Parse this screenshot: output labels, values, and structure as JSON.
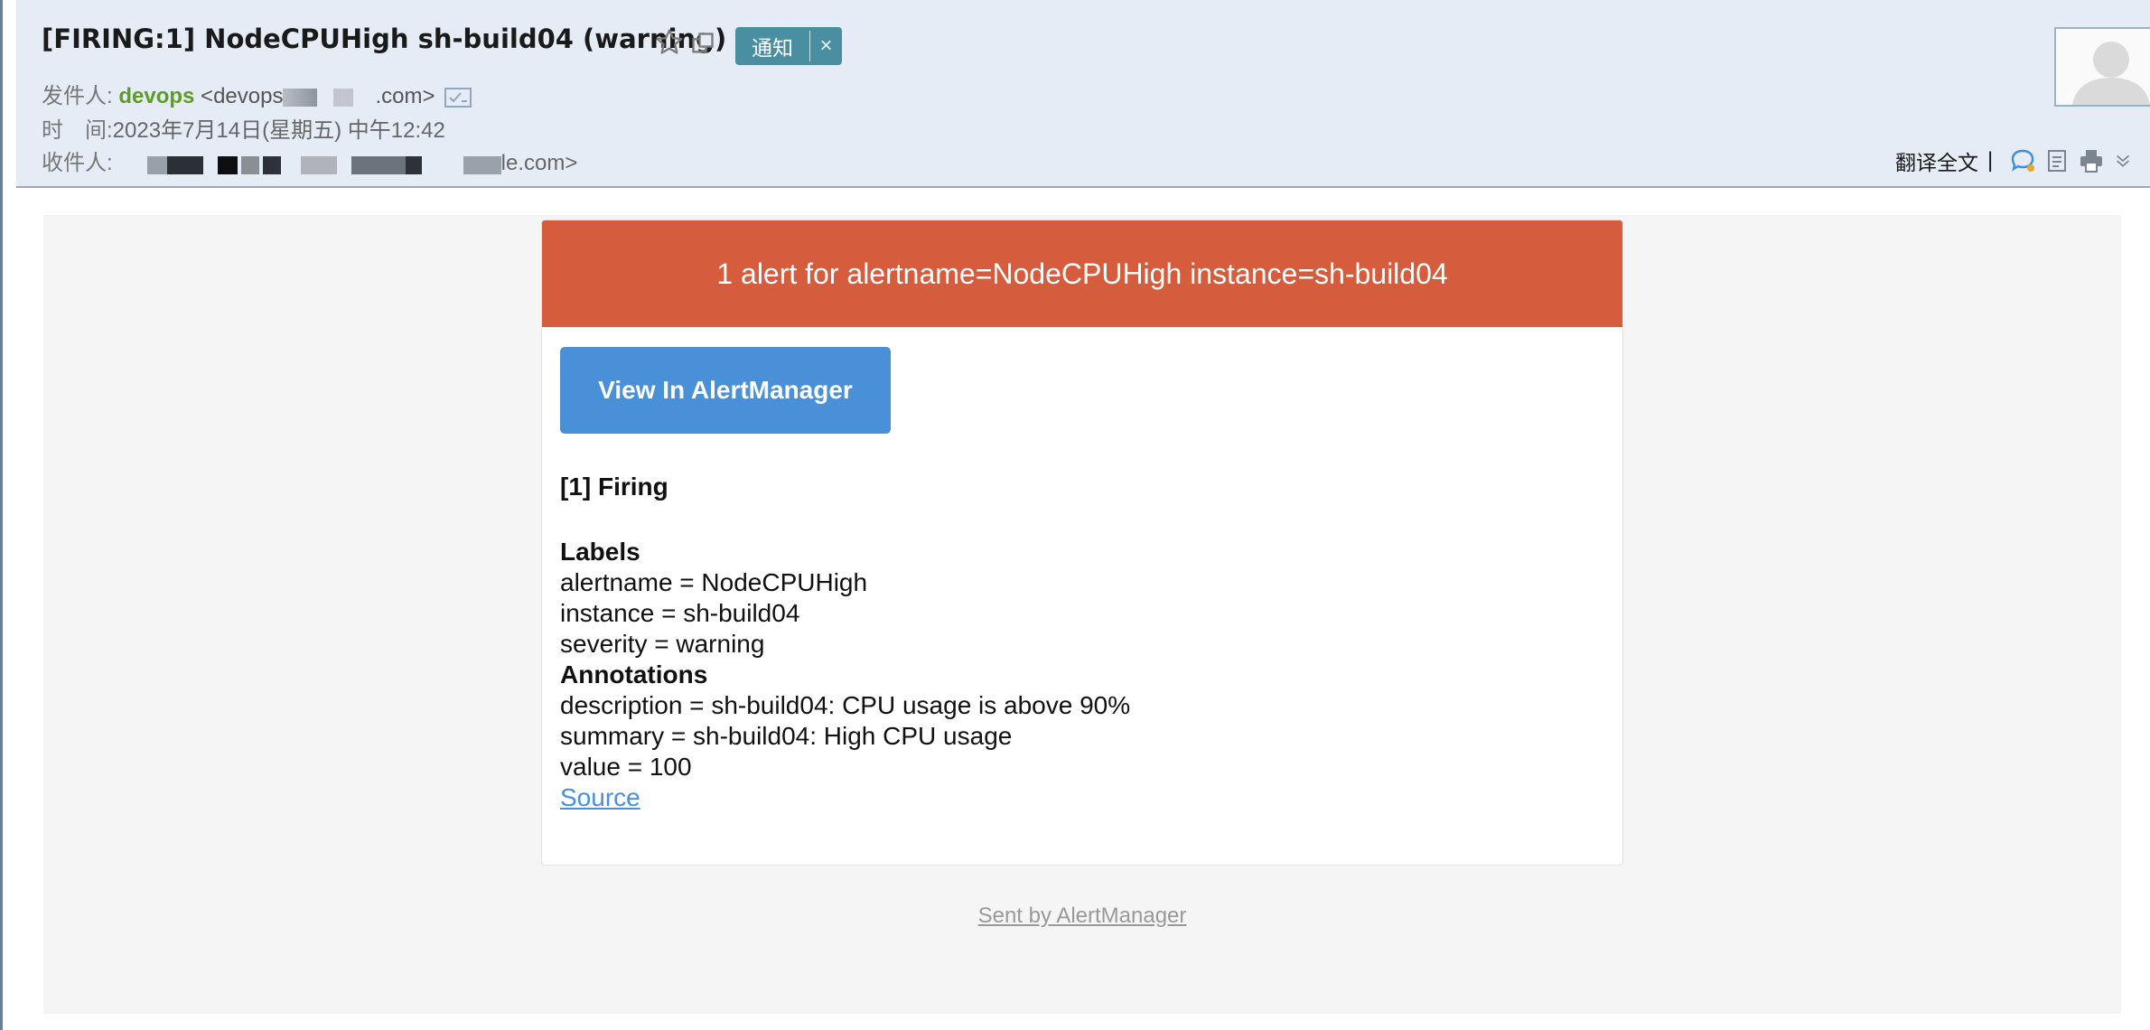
{
  "header": {
    "subject": "[FIRING:1] NodeCPUHigh sh-build04 (warning)",
    "tag_label": "通知",
    "tag_close": "×",
    "sender_label": "发件人:",
    "sender_name": "devops",
    "sender_addr_start": "<devops",
    "sender_addr_end": ".com>",
    "time_label": "时　间:",
    "time_value": "2023年7月14日(星期五) 中午12:42",
    "recipient_label": "收件人:",
    "recipient_end": "le.com>",
    "translate_label": "翻译全文",
    "toolbar_sep": "|"
  },
  "alert": {
    "banner": "1 alert for alertname=NodeCPUHigh instance=sh-build04",
    "button": "View In AlertManager",
    "firing": "[1] Firing",
    "labels_heading": "Labels",
    "labels": [
      "alertname = NodeCPUHigh",
      "instance = sh-build04",
      "severity = warning"
    ],
    "annotations_heading": "Annotations",
    "annotations": [
      "description = sh-build04: CPU usage is above 90%",
      "summary = sh-build04: High CPU usage",
      "value = 100"
    ],
    "source_link": "Source"
  },
  "footer": {
    "sent_by": "Sent by AlertManager"
  },
  "colors": {
    "banner": "#d55c3c",
    "button": "#4a90d9",
    "sender_name": "#5a9e23",
    "tag": "#4a8fa1",
    "header_bg": "#e6ecf5"
  },
  "icons": [
    "star-icon",
    "new-window-icon",
    "contact-icon",
    "avatar-placeholder",
    "chat-icon",
    "note-icon",
    "print-icon",
    "chevron-down-icon"
  ]
}
